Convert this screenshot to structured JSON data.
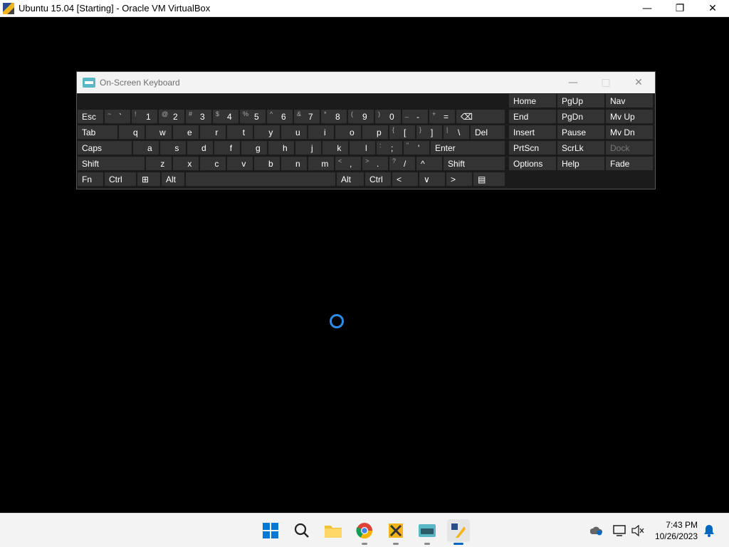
{
  "vbox": {
    "title": "Ubuntu 15.04 [Starting] - Oracle VM VirtualBox",
    "minimize": "—",
    "restore": "❐",
    "close": "✕"
  },
  "osk": {
    "title": "On-Screen Keyboard",
    "minimize": "—",
    "maximize": "□",
    "close": "✕",
    "row1": [
      {
        "label": "Esc"
      },
      {
        "shift": "~",
        "main": "`"
      },
      {
        "shift": "!",
        "main": "1"
      },
      {
        "shift": "@",
        "main": "2"
      },
      {
        "shift": "#",
        "main": "3"
      },
      {
        "shift": "$",
        "main": "4"
      },
      {
        "shift": "%",
        "main": "5"
      },
      {
        "shift": "^",
        "main": "6"
      },
      {
        "shift": "&",
        "main": "7"
      },
      {
        "shift": "*",
        "main": "8"
      },
      {
        "shift": "(",
        "main": "9"
      },
      {
        "shift": ")",
        "main": "0"
      },
      {
        "shift": "_",
        "main": "-"
      },
      {
        "shift": "+",
        "main": "="
      },
      {
        "label": "⌫"
      }
    ],
    "row2": [
      {
        "label": "Tab"
      },
      {
        "label": "q"
      },
      {
        "label": "w"
      },
      {
        "label": "e"
      },
      {
        "label": "r"
      },
      {
        "label": "t"
      },
      {
        "label": "y"
      },
      {
        "label": "u"
      },
      {
        "label": "i"
      },
      {
        "label": "o"
      },
      {
        "label": "p"
      },
      {
        "shift": "{",
        "main": "["
      },
      {
        "shift": "}",
        "main": "]"
      },
      {
        "shift": "|",
        "main": "\\"
      },
      {
        "label": "Del"
      }
    ],
    "row3": [
      {
        "label": "Caps"
      },
      {
        "label": "a"
      },
      {
        "label": "s"
      },
      {
        "label": "d"
      },
      {
        "label": "f"
      },
      {
        "label": "g"
      },
      {
        "label": "h"
      },
      {
        "label": "j"
      },
      {
        "label": "k"
      },
      {
        "label": "l"
      },
      {
        "shift": ":",
        "main": ";"
      },
      {
        "shift": "\"",
        "main": "'"
      },
      {
        "label": "Enter"
      }
    ],
    "row4": [
      {
        "label": "Shift"
      },
      {
        "label": "z"
      },
      {
        "label": "x"
      },
      {
        "label": "c"
      },
      {
        "label": "v"
      },
      {
        "label": "b"
      },
      {
        "label": "n"
      },
      {
        "label": "m"
      },
      {
        "shift": "<",
        "main": ","
      },
      {
        "shift": ">",
        "main": "."
      },
      {
        "shift": "?",
        "main": "/"
      },
      {
        "label": "^"
      },
      {
        "label": "Shift"
      }
    ],
    "row5": [
      {
        "label": "Fn"
      },
      {
        "label": "Ctrl"
      },
      {
        "label": "⊞"
      },
      {
        "label": "Alt"
      },
      {
        "label": ""
      },
      {
        "label": "Alt"
      },
      {
        "label": "Ctrl"
      },
      {
        "label": "<"
      },
      {
        "label": "∨"
      },
      {
        "label": ">"
      },
      {
        "label": "▤"
      }
    ],
    "nav": [
      [
        "Home",
        "PgUp",
        "Nav"
      ],
      [
        "End",
        "PgDn",
        "Mv Up"
      ],
      [
        "Insert",
        "Pause",
        "Mv Dn"
      ],
      [
        "PrtScn",
        "ScrLk",
        "Dock"
      ],
      [
        "Options",
        "Help",
        "Fade"
      ]
    ]
  },
  "taskbar": {
    "time": "7:43 PM",
    "date": "10/26/2023",
    "apps": [
      "start-icon",
      "search-icon",
      "file-explorer-icon",
      "chrome-icon",
      "vm-app-icon",
      "osk-app-icon",
      "virtualbox-icon"
    ]
  }
}
